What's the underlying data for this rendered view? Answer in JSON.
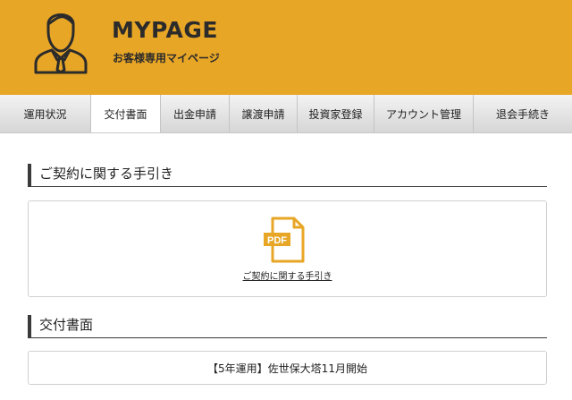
{
  "header": {
    "title": "MYPAGE",
    "subtitle": "お客様専用マイページ",
    "accent_color": "#e8a626",
    "avatar_icon": "businessman-icon"
  },
  "nav": {
    "tabs": [
      {
        "label": "運用状況",
        "active": false
      },
      {
        "label": "交付書面",
        "active": true
      },
      {
        "label": "出金申請",
        "active": false
      },
      {
        "label": "譲渡申請",
        "active": false
      },
      {
        "label": "投資家登録",
        "active": false
      },
      {
        "label": "アカウント管理",
        "active": false
      },
      {
        "label": "退会手続き",
        "active": false
      }
    ]
  },
  "contract_guide": {
    "heading": "ご契約に関する手引き",
    "pdf_icon_label": "PDF",
    "link_label": "ご契約に関する手引き",
    "icon": "pdf-file-icon"
  },
  "delivered_documents": {
    "heading": "交付書面",
    "items": [
      {
        "label": "【5年運用】佐世保大塔11月開始"
      }
    ]
  }
}
